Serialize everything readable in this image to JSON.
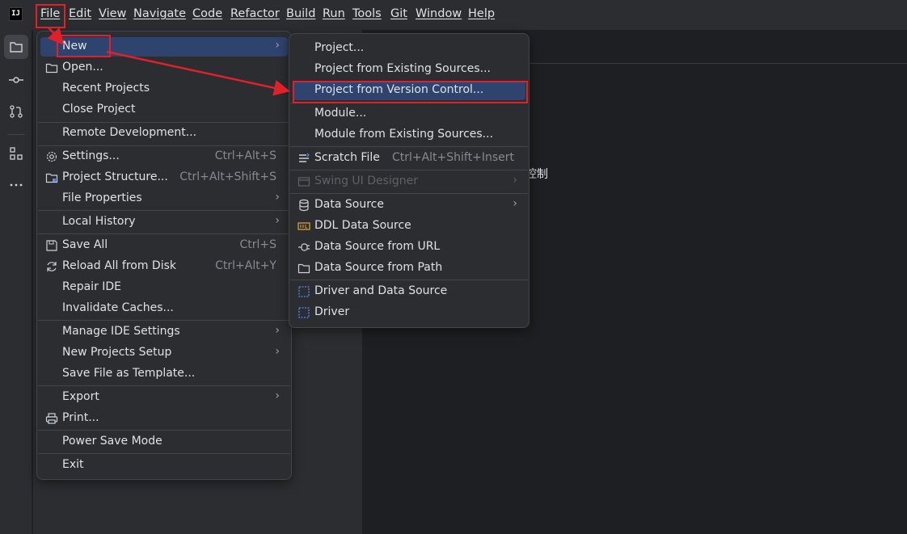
{
  "app": {
    "logo_text": "IJ"
  },
  "menubar": {
    "items": [
      "File",
      "Edit",
      "View",
      "Navigate",
      "Code",
      "Refactor",
      "Build",
      "Run",
      "Tools",
      "Git",
      "Window",
      "Help"
    ]
  },
  "editor": {
    "fragment_text": "控制"
  },
  "file_menu": {
    "items": [
      {
        "label": "New",
        "has_submenu": true,
        "selected": true
      },
      {
        "label": "Open..."
      },
      {
        "label": "Recent Projects",
        "has_submenu": true
      },
      {
        "label": "Close Project"
      },
      {
        "label": "Remote Development..."
      },
      {
        "label": "Settings...",
        "shortcut": "Ctrl+Alt+S"
      },
      {
        "label": "Project Structure...",
        "shortcut": "Ctrl+Alt+Shift+S"
      },
      {
        "label": "File Properties",
        "has_submenu": true
      },
      {
        "label": "Local History",
        "has_submenu": true
      },
      {
        "label": "Save All",
        "shortcut": "Ctrl+S"
      },
      {
        "label": "Reload All from Disk",
        "shortcut": "Ctrl+Alt+Y"
      },
      {
        "label": "Repair IDE"
      },
      {
        "label": "Invalidate Caches..."
      },
      {
        "label": "Manage IDE Settings",
        "has_submenu": true
      },
      {
        "label": "New Projects Setup",
        "has_submenu": true
      },
      {
        "label": "Save File as Template..."
      },
      {
        "label": "Export",
        "has_submenu": true
      },
      {
        "label": "Print..."
      },
      {
        "label": "Power Save Mode"
      },
      {
        "label": "Exit"
      }
    ]
  },
  "new_menu": {
    "items": [
      {
        "label": "Project..."
      },
      {
        "label": "Project from Existing Sources..."
      },
      {
        "label": "Project from Version Control...",
        "selected": true
      },
      {
        "label": "Module..."
      },
      {
        "label": "Module from Existing Sources..."
      },
      {
        "label": "Scratch File",
        "shortcut": "Ctrl+Alt+Shift+Insert"
      },
      {
        "label": "Swing UI Designer",
        "has_submenu": true,
        "disabled": true
      },
      {
        "label": "Data Source",
        "has_submenu": true
      },
      {
        "label": "DDL Data Source"
      },
      {
        "label": "Data Source from URL"
      },
      {
        "label": "Data Source from Path"
      },
      {
        "label": "Driver and Data Source"
      },
      {
        "label": "Driver"
      }
    ]
  },
  "icons": {
    "submenu_arrow": "›",
    "open": "folder-icon",
    "settings": "gear-icon",
    "project_structure": "folder-grid-icon",
    "save_all": "save-icon",
    "reload": "reload-icon",
    "print": "printer-icon",
    "scratch": "scratch-file-icon",
    "swing": "swing-designer-icon",
    "data_source": "database-icon",
    "ddl": "ddl-icon",
    "url": "plug-icon",
    "path": "folder-icon",
    "driver_ds": "driver-icon",
    "driver": "driver-icon"
  },
  "colors": {
    "background": "#1e1f22",
    "panel": "#2b2d30",
    "selection": "#2e436e",
    "annotation": "#e0212a"
  }
}
